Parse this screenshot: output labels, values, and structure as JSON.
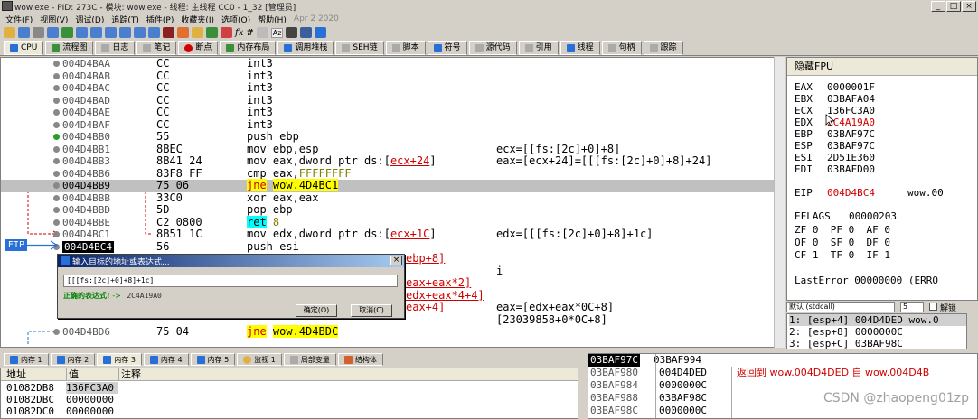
{
  "window": {
    "title": "wow.exe - PID: 273C - 模块: wow.exe - 线程: 主线程 CC0 - 1_32 [管理员]",
    "buttons": [
      "_",
      "□",
      "×"
    ]
  },
  "menu": [
    {
      "label": "文件(F)"
    },
    {
      "label": "视图(V)"
    },
    {
      "label": "调试(D)"
    },
    {
      "label": "追踪(T)"
    },
    {
      "label": "插件(P)"
    },
    {
      "label": "收藏夹(I)"
    },
    {
      "label": "选项(O)"
    },
    {
      "label": "帮助(H)"
    },
    {
      "label": "Apr 2 2020"
    }
  ],
  "toolbar": {
    "fx": "fx",
    "hash": "#",
    "az": "Az"
  },
  "tabs": [
    {
      "label": "CPU",
      "color": "#2a6fd6"
    },
    {
      "label": "流程图",
      "color": "#3a8f3a"
    },
    {
      "label": "日志",
      "color": "#888"
    },
    {
      "label": "笔记",
      "color": "#888"
    },
    {
      "label": "断点",
      "color": "#d00000"
    },
    {
      "label": "内存布局",
      "color": "#3a8f3a"
    },
    {
      "label": "调用堆栈",
      "color": "#2a6fd6"
    },
    {
      "label": "SEH链",
      "color": "#888"
    },
    {
      "label": "脚本",
      "color": "#888"
    },
    {
      "label": "符号",
      "color": "#2a6fd6"
    },
    {
      "label": "源代码",
      "color": "#888"
    },
    {
      "label": "引用",
      "color": "#888"
    },
    {
      "label": "线程",
      "color": "#2a6fd6"
    },
    {
      "label": "句柄",
      "color": "#888"
    },
    {
      "label": "跟踪",
      "color": "#888"
    }
  ],
  "disasm": [
    {
      "addr": "004D4BAA",
      "bytes": "CC",
      "instr": "int3",
      "cmt": ""
    },
    {
      "addr": "004D4BAB",
      "bytes": "CC",
      "instr": "int3",
      "cmt": ""
    },
    {
      "addr": "004D4BAC",
      "bytes": "CC",
      "instr": "int3",
      "cmt": ""
    },
    {
      "addr": "004D4BAD",
      "bytes": "CC",
      "instr": "int3",
      "cmt": ""
    },
    {
      "addr": "004D4BAE",
      "bytes": "CC",
      "instr": "int3",
      "cmt": ""
    },
    {
      "addr": "004D4BAF",
      "bytes": "CC",
      "instr": "int3",
      "cmt": ""
    },
    {
      "addr": "004D4BB0",
      "bytes": "55",
      "instr": "push ebp",
      "cmt": ""
    },
    {
      "addr": "004D4BB1",
      "bytes": "8BEC",
      "instr": "mov ebp,esp",
      "cmt": "ecx=[[fs:[2c]+0]+8]"
    },
    {
      "addr": "004D4BB3",
      "bytes": "8B41 24",
      "instr_pre": "mov eax,dword ptr ds:[",
      "instr_reg": "ecx+24",
      "instr_post": "]",
      "cmt": "eax=[ecx+24]=[[[fs:[2c]+0]+8]+24]"
    },
    {
      "addr": "004D4BB6",
      "bytes": "83F8 FF",
      "instr_pre": "cmp eax,",
      "instr_imm": "FFFFFFFF",
      "cmt": ""
    },
    {
      "addr": "004D4BB9",
      "bytes": "75 06",
      "instr_mn": "jne",
      "instr_op": "wow.4D4BC1",
      "cmt": ""
    },
    {
      "addr": "004D4BBB",
      "bytes": "33C0",
      "instr": "xor eax,eax",
      "cmt": ""
    },
    {
      "addr": "004D4BBD",
      "bytes": "5D",
      "instr": "pop ebp",
      "cmt": ""
    },
    {
      "addr": "004D4BBE",
      "bytes": "C2 0800",
      "instr_mn": "ret",
      "instr_op": "8",
      "cmt": ""
    },
    {
      "addr": "004D4BC1",
      "bytes": "8B51 1C",
      "instr_pre": "mov edx,dword ptr ds:[",
      "instr_reg": "ecx+1C",
      "instr_post": "]",
      "cmt": "edx=[[[fs:[2c]+0]+8]+1c]"
    },
    {
      "addr": "004D4BC4",
      "bytes": "56",
      "instr": "push esi",
      "cmt": ""
    },
    {
      "addr": "",
      "bytes": "",
      "instr_tail": "ebp+8]",
      "cmt": ""
    },
    {
      "addr": "",
      "bytes": "",
      "instr": "",
      "cmt": "i"
    },
    {
      "addr": "",
      "bytes": "",
      "instr_tail": "eax+eax*2]",
      "cmt": ""
    },
    {
      "addr": "",
      "bytes": "",
      "instr_tail": "edx+eax*4+4]",
      "cmt": ""
    },
    {
      "addr": "",
      "bytes": "",
      "instr_tail": "eax+4]",
      "cmt": "eax=[edx+eax*0C+8]"
    },
    {
      "addr": "",
      "bytes": "",
      "instr": "",
      "cmt": "[23039858+0*0C+8]"
    },
    {
      "addr": "004D4BD6",
      "bytes": "75 04",
      "instr_mn": "jne",
      "instr_op": "wow.4D4BDC",
      "cmt": ""
    }
  ],
  "eip_label": "EIP",
  "dialog": {
    "title": "输入目标的地址或表达式...",
    "input": "[[[fs:[2c]+0]+8]+1c]",
    "status_prefix": "正确的表达式!",
    "status_arrow": "->",
    "status_value": "2C4A19A0",
    "ok": "确定(O)",
    "cancel": "取消(C)"
  },
  "registers": {
    "header": "隐藏FPU",
    "gp": [
      {
        "name": "EAX",
        "value": "0000001F",
        "changed": false
      },
      {
        "name": "EBX",
        "value": "03BAFA04",
        "changed": false
      },
      {
        "name": "ECX",
        "value": "136FC3A0",
        "changed": false
      },
      {
        "name": "EDX",
        "value": "2C4A19A0",
        "changed": true
      },
      {
        "name": "EBP",
        "value": "03BAF97C",
        "changed": false
      },
      {
        "name": "ESP",
        "value": "03BAF97C",
        "changed": false
      },
      {
        "name": "ESI",
        "value": "2D51E360",
        "changed": false
      },
      {
        "name": "EDI",
        "value": "03BAFD00",
        "changed": false
      }
    ],
    "eip": {
      "name": "EIP",
      "value": "004D4BC4",
      "module": "wow.00"
    },
    "eflags": {
      "name": "EFLAGS",
      "value": "00000203"
    },
    "flags_rows": [
      "ZF 0  PF 0  AF 0",
      "OF 0  SF 0  DF 0",
      "CF 1  TF 0  IF 1"
    ],
    "last_error": "LastError  00000000 (ERRO"
  },
  "stack_ctrl": {
    "convention": "默认 (stdcall)",
    "count": "5",
    "unlock": "解锁"
  },
  "stack_args": [
    "1: [esp+4] 004D4DED wow.0",
    "2: [esp+8] 0000000C",
    "3: [esp+C] 03BAF98C"
  ],
  "bottom_tabs": [
    {
      "label": "内存 1"
    },
    {
      "label": "内存 2"
    },
    {
      "label": "内存 3"
    },
    {
      "label": "内存 4"
    },
    {
      "label": "内存 5"
    },
    {
      "label": "监视 1"
    },
    {
      "label": "局部变量"
    },
    {
      "label": "结构体"
    }
  ],
  "dump": {
    "headers": [
      "地址",
      "值",
      "注释"
    ],
    "rows": [
      {
        "addr": "01082DB8",
        "val": "136FC3A0"
      },
      {
        "addr": "01082DBC",
        "val": "00000000"
      },
      {
        "addr": "01082DC0",
        "val": "00000000"
      }
    ]
  },
  "bstack": {
    "top_addr": "03BAF97C",
    "top_val": "03BAF994",
    "rows": [
      {
        "addr": "03BAF980",
        "val": "004D4DED",
        "cmt": "返回到 wow.004D4DED 自 wow.004D4B"
      },
      {
        "addr": "03BAF984",
        "val": "0000000C",
        "cmt": ""
      },
      {
        "addr": "03BAF988",
        "val": "03BAF98C",
        "cmt": ""
      },
      {
        "addr": "03BAF98C",
        "val": "0000000C",
        "cmt": ""
      }
    ]
  },
  "watermark": "CSDN @zhaopeng01zp"
}
